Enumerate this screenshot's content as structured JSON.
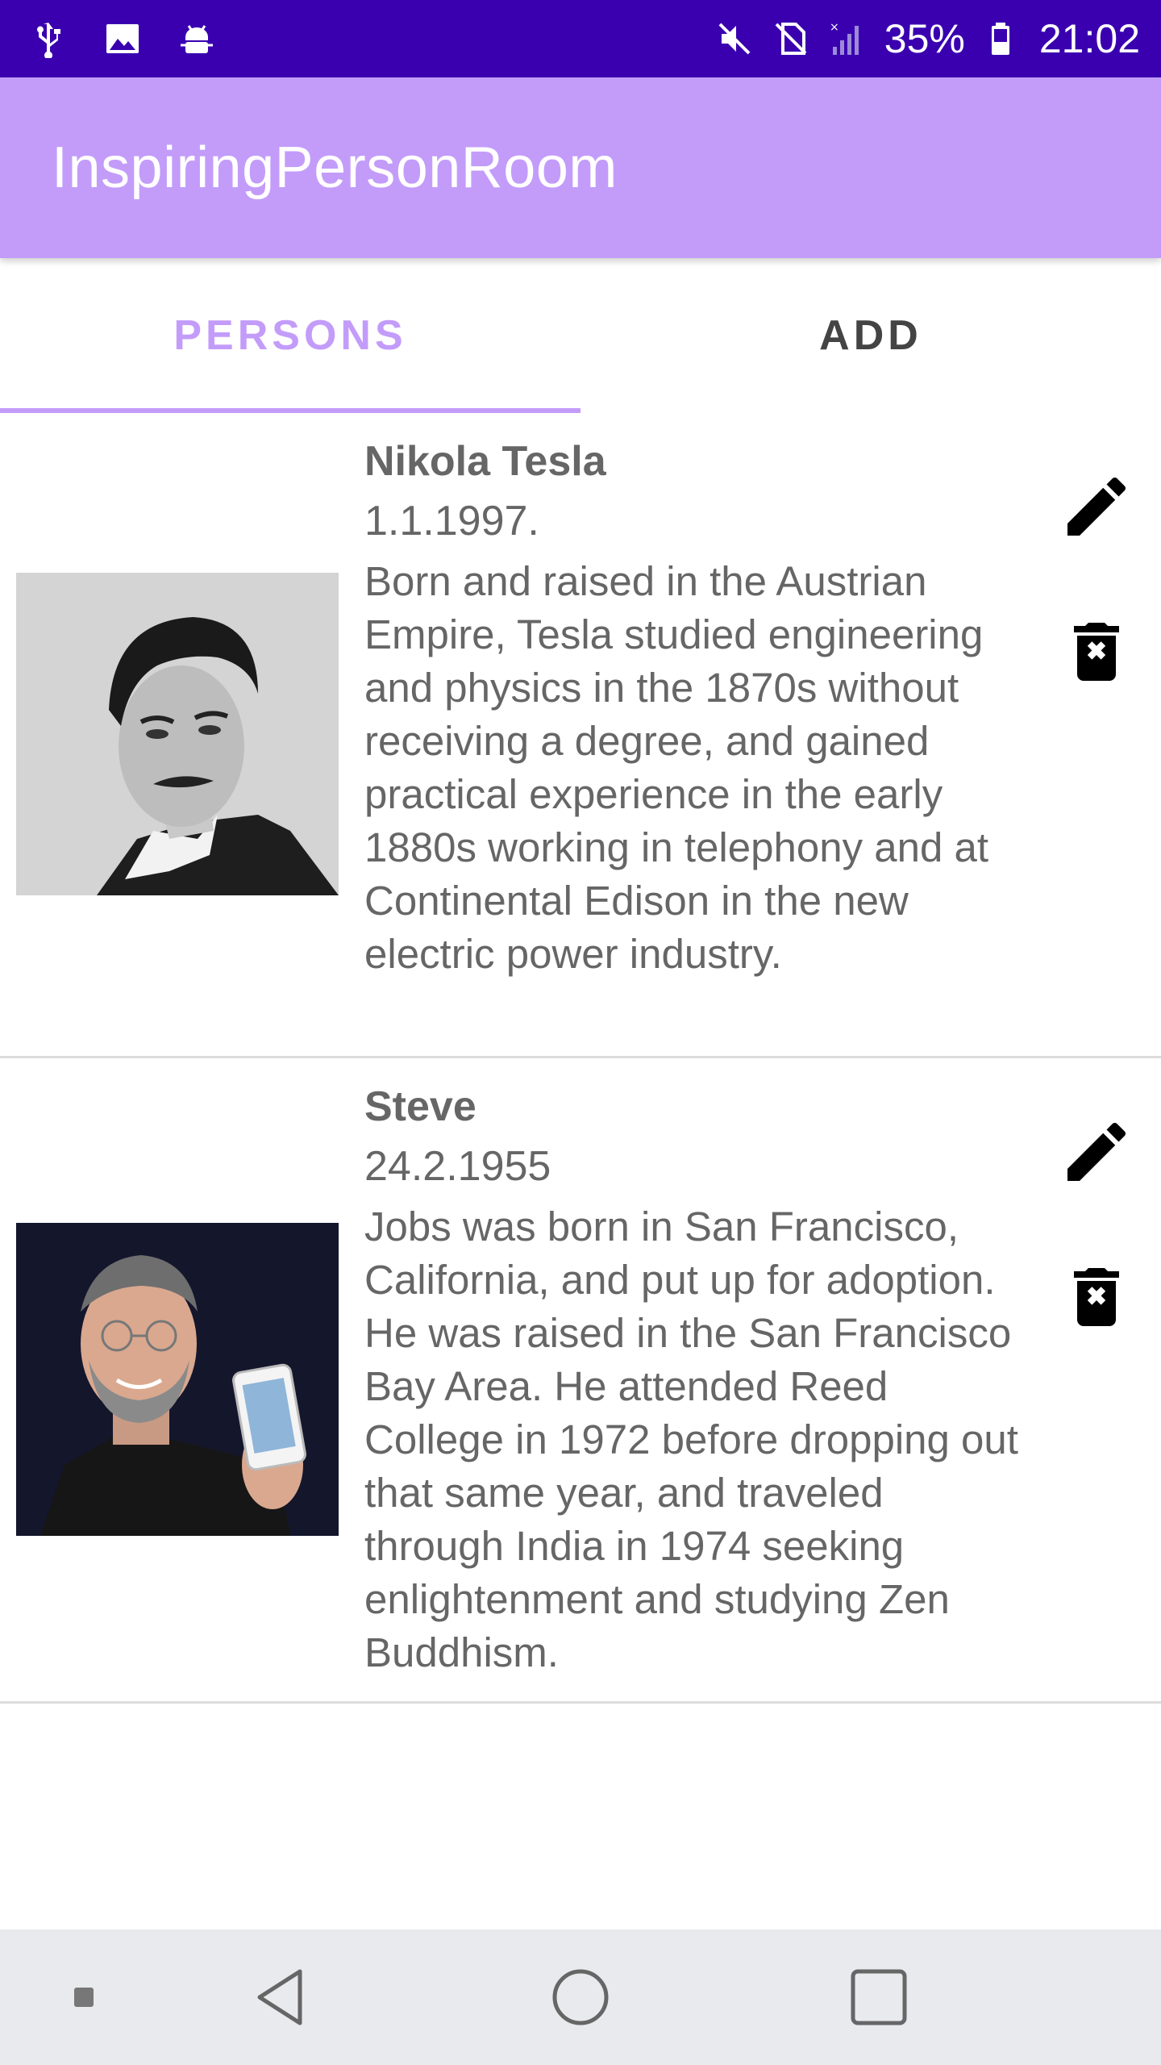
{
  "status_bar": {
    "battery": "35%",
    "time": "21:02",
    "left_icons": [
      "usb-icon",
      "image-icon",
      "android-debug-icon"
    ],
    "right_icons": [
      "mute-icon",
      "no-sim-icon",
      "signal-icon",
      "battery-icon"
    ]
  },
  "app_bar": {
    "title": "InspiringPersonRoom",
    "color": "#c39cfa"
  },
  "tabs": [
    {
      "label": "PERSONS",
      "active": true
    },
    {
      "label": "ADD",
      "active": false
    }
  ],
  "persons": [
    {
      "name": "Nikola Tesla",
      "date": "1.1.1997.",
      "description": "Born and raised in the Austrian Empire, Tesla studied engineering and physics in the 1870s without receiving a degree, and gained practical experience in the early 1880s working in telephony and at Continental Edison in the new electric power industry.",
      "photo": "portrait-photo",
      "edit_icon": "pencil-icon",
      "delete_icon": "delete-forever-icon"
    },
    {
      "name": "Steve",
      "date": "24.2.1955",
      "description": "Jobs was born in San Francisco, California, and put up for adoption. He was raised in the San Francisco Bay Area. He attended Reed College in 1972 before dropping out that same year, and traveled through India in 1974 seeking enlightenment and studying Zen Buddhism.",
      "photo": "portrait-photo",
      "edit_icon": "pencil-icon",
      "delete_icon": "delete-forever-icon"
    }
  ],
  "nav_bar": {
    "buttons": [
      "dot-icon",
      "back-icon",
      "home-icon",
      "recents-icon"
    ],
    "background": "#e9eaee"
  },
  "colors": {
    "status_bar": "#3a00b0",
    "accent": "#c39cfa",
    "text": "#666666"
  }
}
